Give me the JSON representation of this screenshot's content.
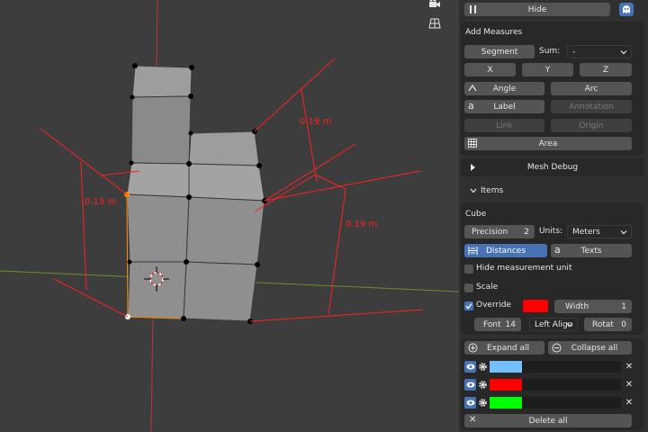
{
  "viewport": {
    "measure_labels": [
      "0.19 m",
      "0.19 m",
      "0.19 m"
    ],
    "tool_icons": [
      "camera-icon",
      "grid-icon"
    ]
  },
  "panel": {
    "top": {
      "hide_label": "Hide"
    },
    "add_measures": {
      "title": "Add Measures",
      "segment": "Segment",
      "sum_label": "Sum:",
      "sum_value": "-",
      "x": "X",
      "y": "Y",
      "z": "Z",
      "angle": "Angle",
      "arc": "Arc",
      "label": "Label",
      "annotation": "Annotation",
      "link": "Link",
      "origin": "Origin",
      "area": "Area"
    },
    "mesh_debug": {
      "label": "Mesh Debug"
    },
    "items": {
      "header": "Items",
      "object": "Cube",
      "precision_label": "Precision",
      "precision_value": "2",
      "units_label": "Units:",
      "units_value": "Meters",
      "distances": "Distances",
      "texts": "Texts",
      "hide_unit": "Hide measurement unit",
      "scale": "Scale",
      "override": "Override",
      "override_color": "#ff0000",
      "width_label": "Width",
      "width_value": "1",
      "font_label": "Font",
      "font_value": "14",
      "align_value": "Left Align",
      "rotat_label": "Rotat",
      "rotat_value": "0"
    },
    "list": {
      "expand_all": "Expand all",
      "collapse_all": "Collapse all",
      "rows": [
        {
          "color": "#74c0fc"
        },
        {
          "color": "#ff0000"
        },
        {
          "color": "#00ff00"
        }
      ],
      "delete_all": "Delete all"
    }
  },
  "colors": {
    "accent": "#4772b3",
    "measure": "#ff2020",
    "panel_bg": "#303030",
    "viewport_bg": "#3d3d3d"
  }
}
